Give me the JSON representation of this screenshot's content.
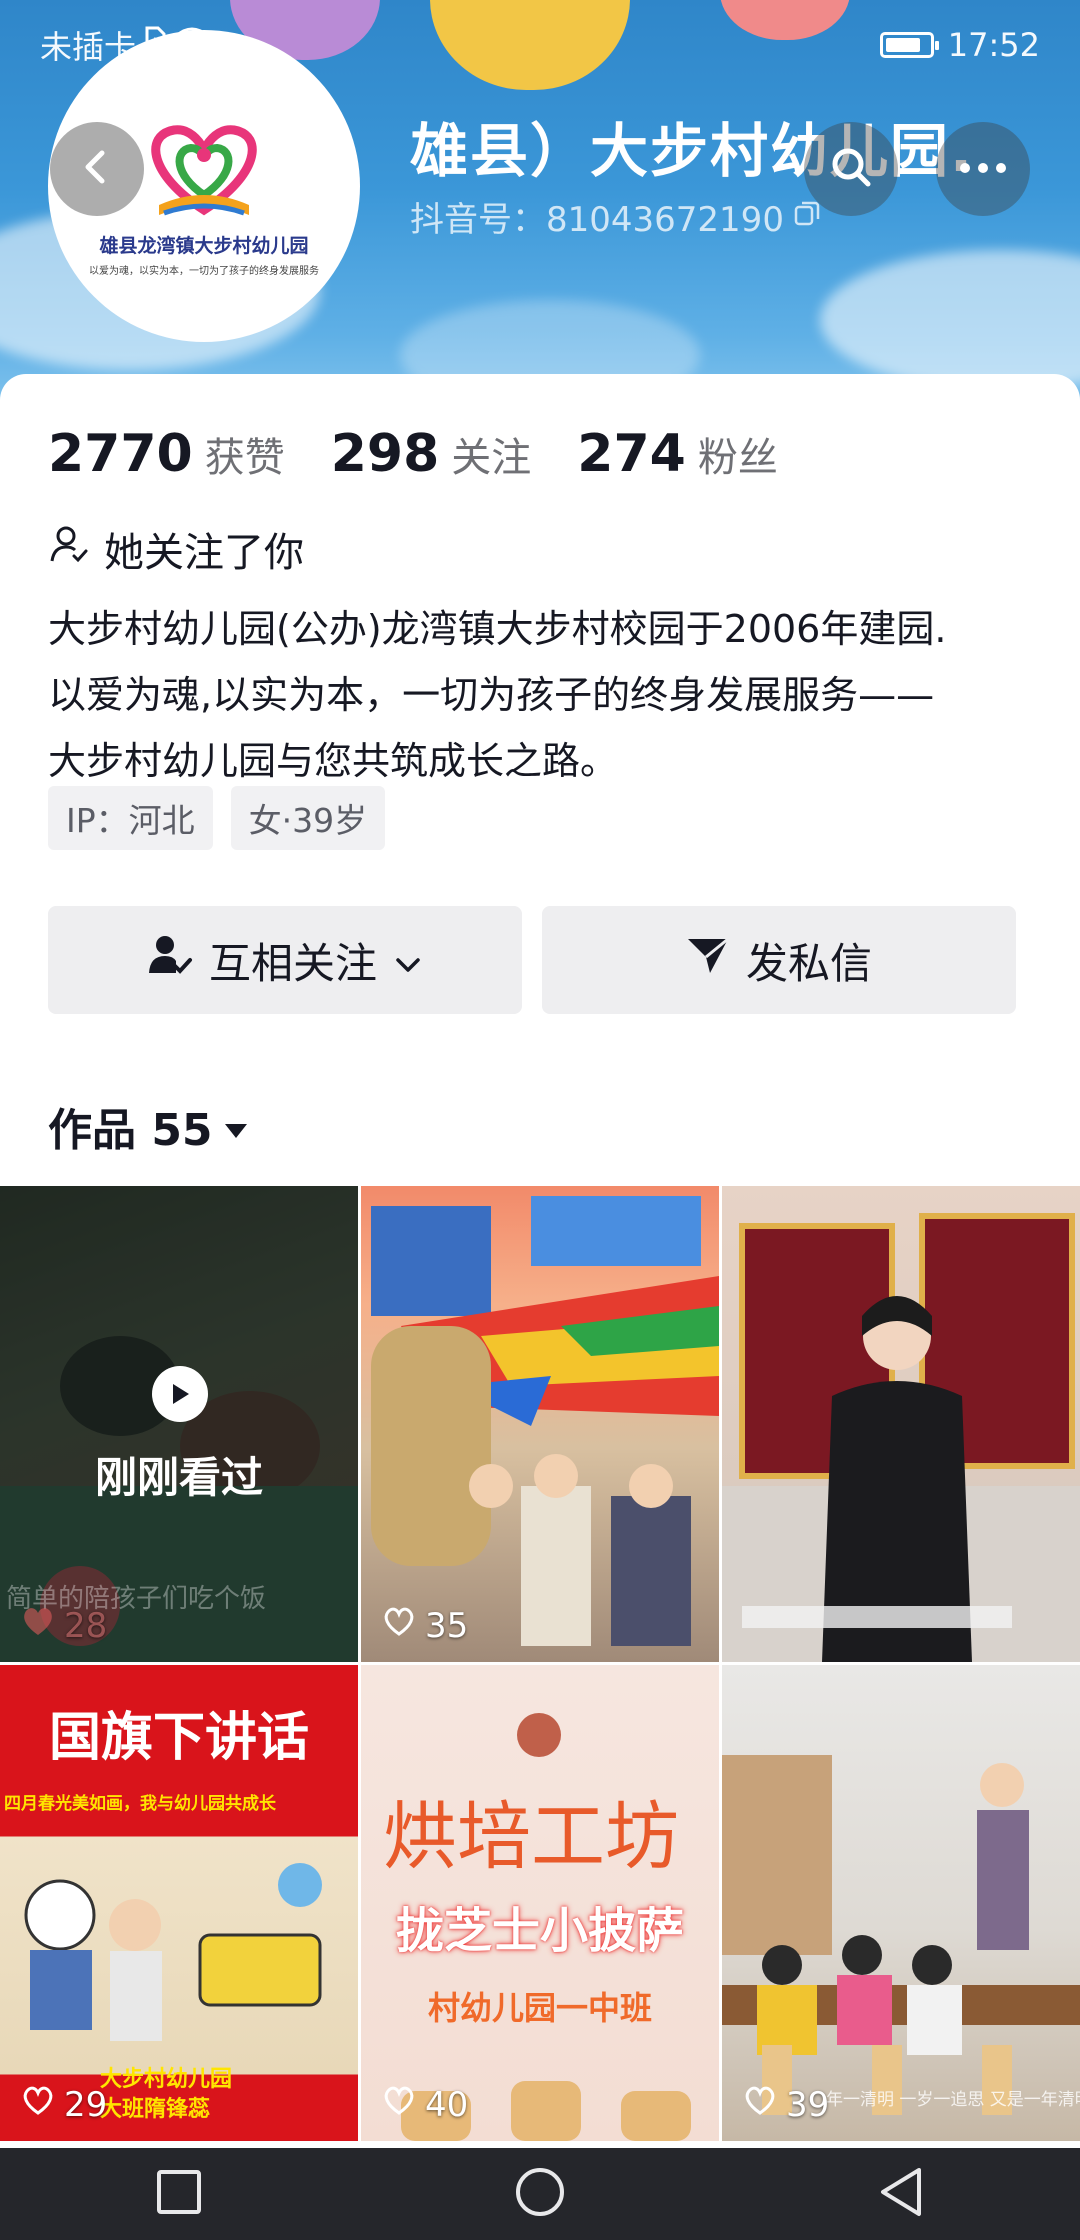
{
  "status_bar": {
    "carrier": "未插卡",
    "time": "17:52"
  },
  "profile": {
    "name": "雄县）大步村幼儿园.",
    "douyin_id": "抖音号：81043672190",
    "avatar_logo_text": "雄县龙湾镇大步村幼儿园",
    "avatar_logo_motto": "以爱为魂，以实为本，一切为了孩子的终身发展服务"
  },
  "stats": [
    {
      "num": "2770",
      "label": "获赞"
    },
    {
      "num": "298",
      "label": "关注"
    },
    {
      "num": "274",
      "label": "粉丝"
    }
  ],
  "follow_status": "她关注了你",
  "bio": [
    "大步村幼儿园(公办)龙湾镇大步村校园于2006年建园.",
    "以爱为魂,以实为本，一切为孩子的终身发展服务——",
    "大步村幼儿园与您共筑成长之路。"
  ],
  "tags": [
    "IP：河北",
    "女·39岁"
  ],
  "actions": {
    "mutual_follow": "互相关注",
    "message": "发私信"
  },
  "works": {
    "label": "作品 55"
  },
  "grid": [
    {
      "likes": "28",
      "overlay": "刚刚看过",
      "caption": "简单的陪孩子们吃个饭"
    },
    {
      "likes": "35"
    },
    {
      "likes": ""
    },
    {
      "likes": "29",
      "title": "国旗下讲话",
      "subtitle": "四月春光美如画，我与幼儿园共成长",
      "bottom": "大步村幼儿园 大班隋锋蕊"
    },
    {
      "likes": "40",
      "title": "烘培工坊",
      "subtitle": "拢芝士小披萨",
      "bottom": "村幼儿园一中班"
    },
    {
      "likes": "39",
      "caption": "年一清明 一岁一追思 又是一年清明"
    }
  ],
  "colors": {
    "banner": "#3b97d8",
    "button_bg": "#eeeef0",
    "text_primary": "#161823",
    "text_secondary": "#6f7075"
  }
}
